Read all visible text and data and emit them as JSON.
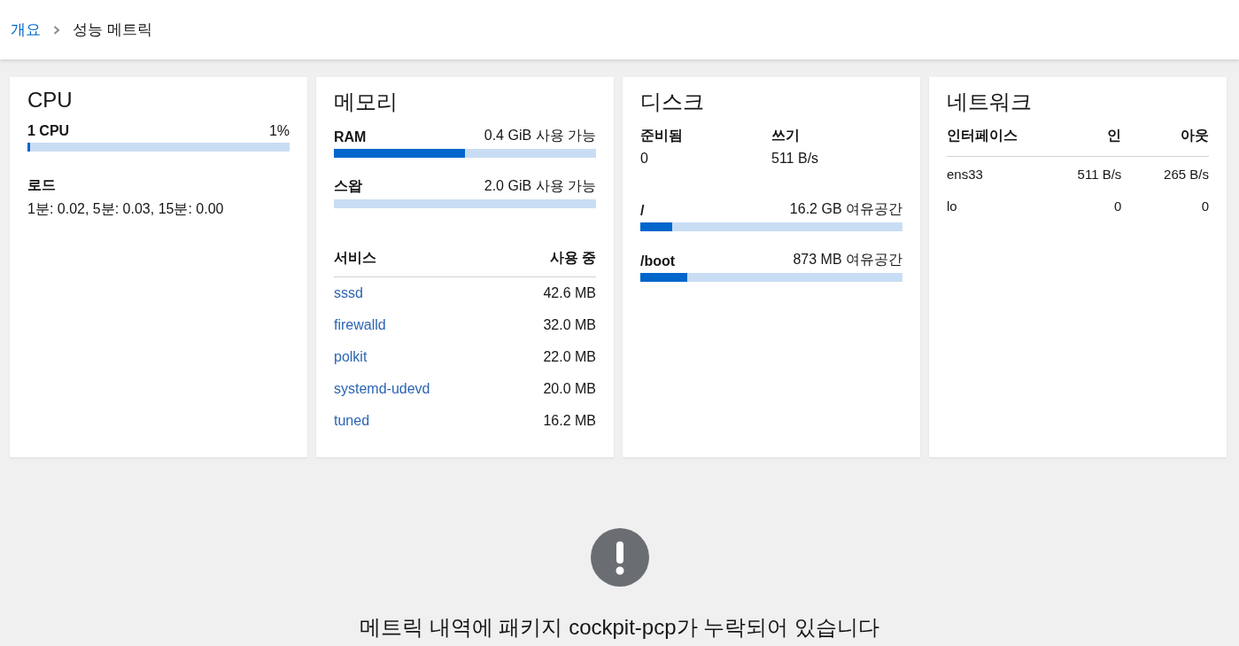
{
  "breadcrumb": [
    {
      "label": "개요",
      "kind": "link"
    },
    {
      "label": "성능 메트릭",
      "kind": "current"
    }
  ],
  "cpu": {
    "title": "CPU",
    "meter": {
      "label": "1 CPU",
      "reading": "1%",
      "level": 0.01
    },
    "load": {
      "label": "로드",
      "value": "1분: 0.02, 5분: 0.03, 15분: 0.00"
    }
  },
  "memory": {
    "title": "메모리",
    "meters": [
      {
        "label": "RAM",
        "reading": "0.4 GiB 사용 가능",
        "level": 0.5
      },
      {
        "label": "스왑",
        "reading": "2.0 GiB 사용 가능"
      }
    ],
    "services": {
      "columns": [
        "서비스",
        "사용 중"
      ],
      "rows": [
        {
          "name": "sssd",
          "usage": "42.6 MB"
        },
        {
          "name": "firewalld",
          "usage": "32.0 MB"
        },
        {
          "name": "polkit",
          "usage": "22.0 MB"
        },
        {
          "name": "systemd-udevd",
          "usage": "20.0 MB"
        },
        {
          "name": "tuned",
          "usage": "16.2 MB"
        }
      ]
    }
  },
  "disk": {
    "title": "디스크",
    "io": [
      {
        "label": "준비됨",
        "value": "0"
      },
      {
        "label": "쓰기",
        "value": "511 B/s"
      }
    ],
    "mounts": [
      {
        "label": "/",
        "reading": "16.2 GB 여유공간",
        "level": 0.12
      },
      {
        "label": "/boot",
        "reading": "873 MB 여유공간",
        "level": 0.18
      }
    ]
  },
  "network": {
    "title": "네트워크",
    "columns": [
      "인터페이스",
      "인",
      "아웃"
    ],
    "rows": [
      {
        "cells": [
          "ens33",
          "511 B/s",
          "265 B/s"
        ]
      },
      {
        "cells": [
          "lo",
          "0",
          "0"
        ]
      }
    ]
  },
  "empty_state": {
    "message": "메트릭 내역에 패키지 cockpit-pcp가 누락되어 있습니다"
  }
}
